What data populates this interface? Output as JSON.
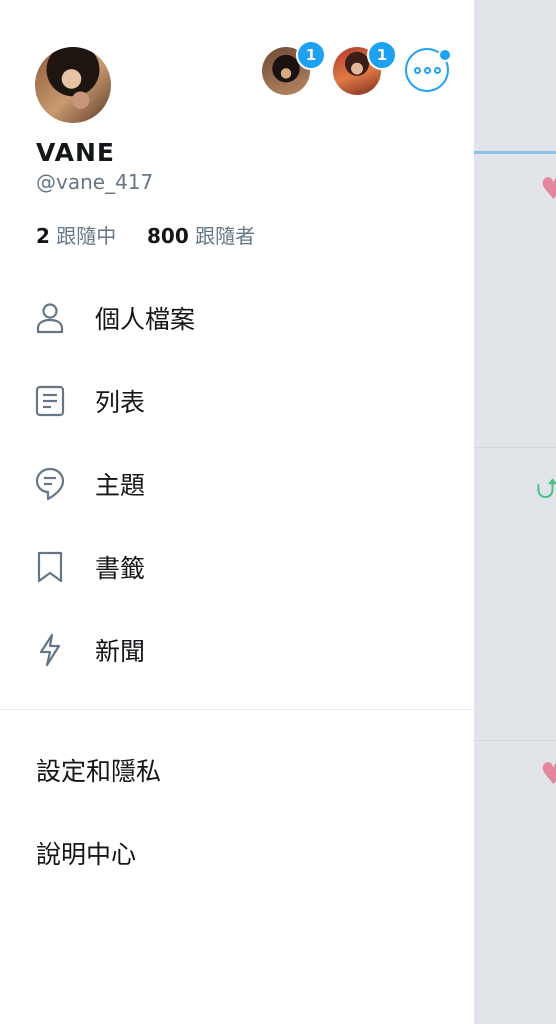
{
  "status_bar": {
    "left": "••••",
    "right": "▪ ▮"
  },
  "profile": {
    "display_name": "VANE",
    "handle": "@vane_417",
    "following_count": "2",
    "following_label": "跟隨中",
    "followers_count": "800",
    "followers_label": "跟隨者"
  },
  "accounts": [
    {
      "badge": "1"
    },
    {
      "badge": "1"
    }
  ],
  "menu": [
    {
      "label": "個人檔案",
      "icon": "person-icon"
    },
    {
      "label": "列表",
      "icon": "list-icon"
    },
    {
      "label": "主題",
      "icon": "topic-icon"
    },
    {
      "label": "書籤",
      "icon": "bookmark-icon"
    },
    {
      "label": "新聞",
      "icon": "lightning-icon"
    }
  ],
  "secondary": {
    "settings": "設定和隱私",
    "help": "說明中心"
  },
  "colors": {
    "accent": "#1da1f2",
    "text_primary": "#14171a",
    "text_secondary": "#657786",
    "icon": "#657786",
    "background_timeline": "#e1e5ea"
  }
}
